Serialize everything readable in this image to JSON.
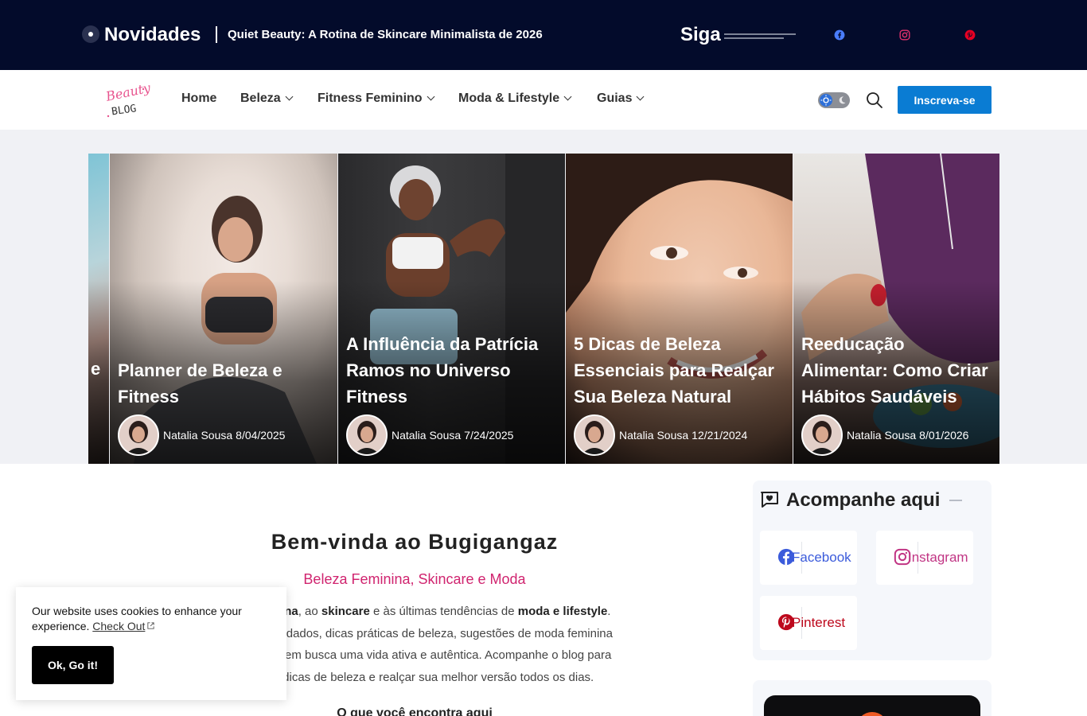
{
  "topbar": {
    "news_label": "Novidades",
    "headline": "Quiet Beauty: A Rotina de Skincare Minimalista de 2026",
    "follow_label": "Siga",
    "social": [
      {
        "icon": "facebook-icon",
        "color": "#4a7dff"
      },
      {
        "icon": "instagram-icon",
        "color": "#e1306c"
      },
      {
        "icon": "pinterest-icon",
        "color": "#e60023"
      }
    ]
  },
  "nav": {
    "logo": {
      "line1": "Beauty",
      "line2": "BLOG"
    },
    "items": [
      "Home",
      "Beleza",
      "Fitness Feminino",
      "Moda & Lifestyle",
      "Guias"
    ],
    "subscribe": "Inscreva-se"
  },
  "slider": {
    "cards": [
      {
        "title": "e",
        "author": "",
        "date": ""
      },
      {
        "title": "Planner de Beleza e Fitness",
        "author": "Natalia Sousa",
        "date": "8/04/2025"
      },
      {
        "title": "A Influência da Patrícia Ramos no Universo Fitness",
        "author": "Natalia Sousa",
        "date": "7/24/2025"
      },
      {
        "title": "5 Dicas de Beleza Essenciais para Realçar Sua Beleza Natural",
        "author": "Natalia Sousa",
        "date": "12/21/2024"
      },
      {
        "title": "Reeducação Alimentar: Como Criar Hábitos Saudáveis",
        "author": "Natalia Sousa",
        "date": "8/01/2026"
      }
    ]
  },
  "main": {
    "title": "Bem-vinda ao Bugigangaz",
    "subtitle": "Beleza Feminina, Skincare e Moda",
    "para": {
      "s1": "leza feminina",
      "s2": ", ao ",
      "s3": "skincare",
      "s4": " e às últimas tendências de ",
      "s5": "moda e lifestyle",
      "s6": ".",
      "line2": "rotina de cuidados, dicas práticas de beleza, sugestões de moda feminina",
      "line3": "verso de quem busca uma vida ativa e autêntica. Acompanhe o blog para",
      "line4": "r novas dicas de beleza e realçar sua melhor versão todos os dias."
    },
    "section_heading": "O que você encontra aqui"
  },
  "sidebar": {
    "follow_title": "Acompanhe aqui",
    "socials": [
      {
        "label": "Facebook",
        "color": "#3b5bdb"
      },
      {
        "label": "Instagram",
        "color": "#c13584"
      },
      {
        "label": "Pinterest",
        "color": "#bd081c"
      }
    ]
  },
  "cookie": {
    "text": "Our website uses cookies to enhance your experience.",
    "link": "Check Out",
    "button": "Ok, Go it!"
  }
}
